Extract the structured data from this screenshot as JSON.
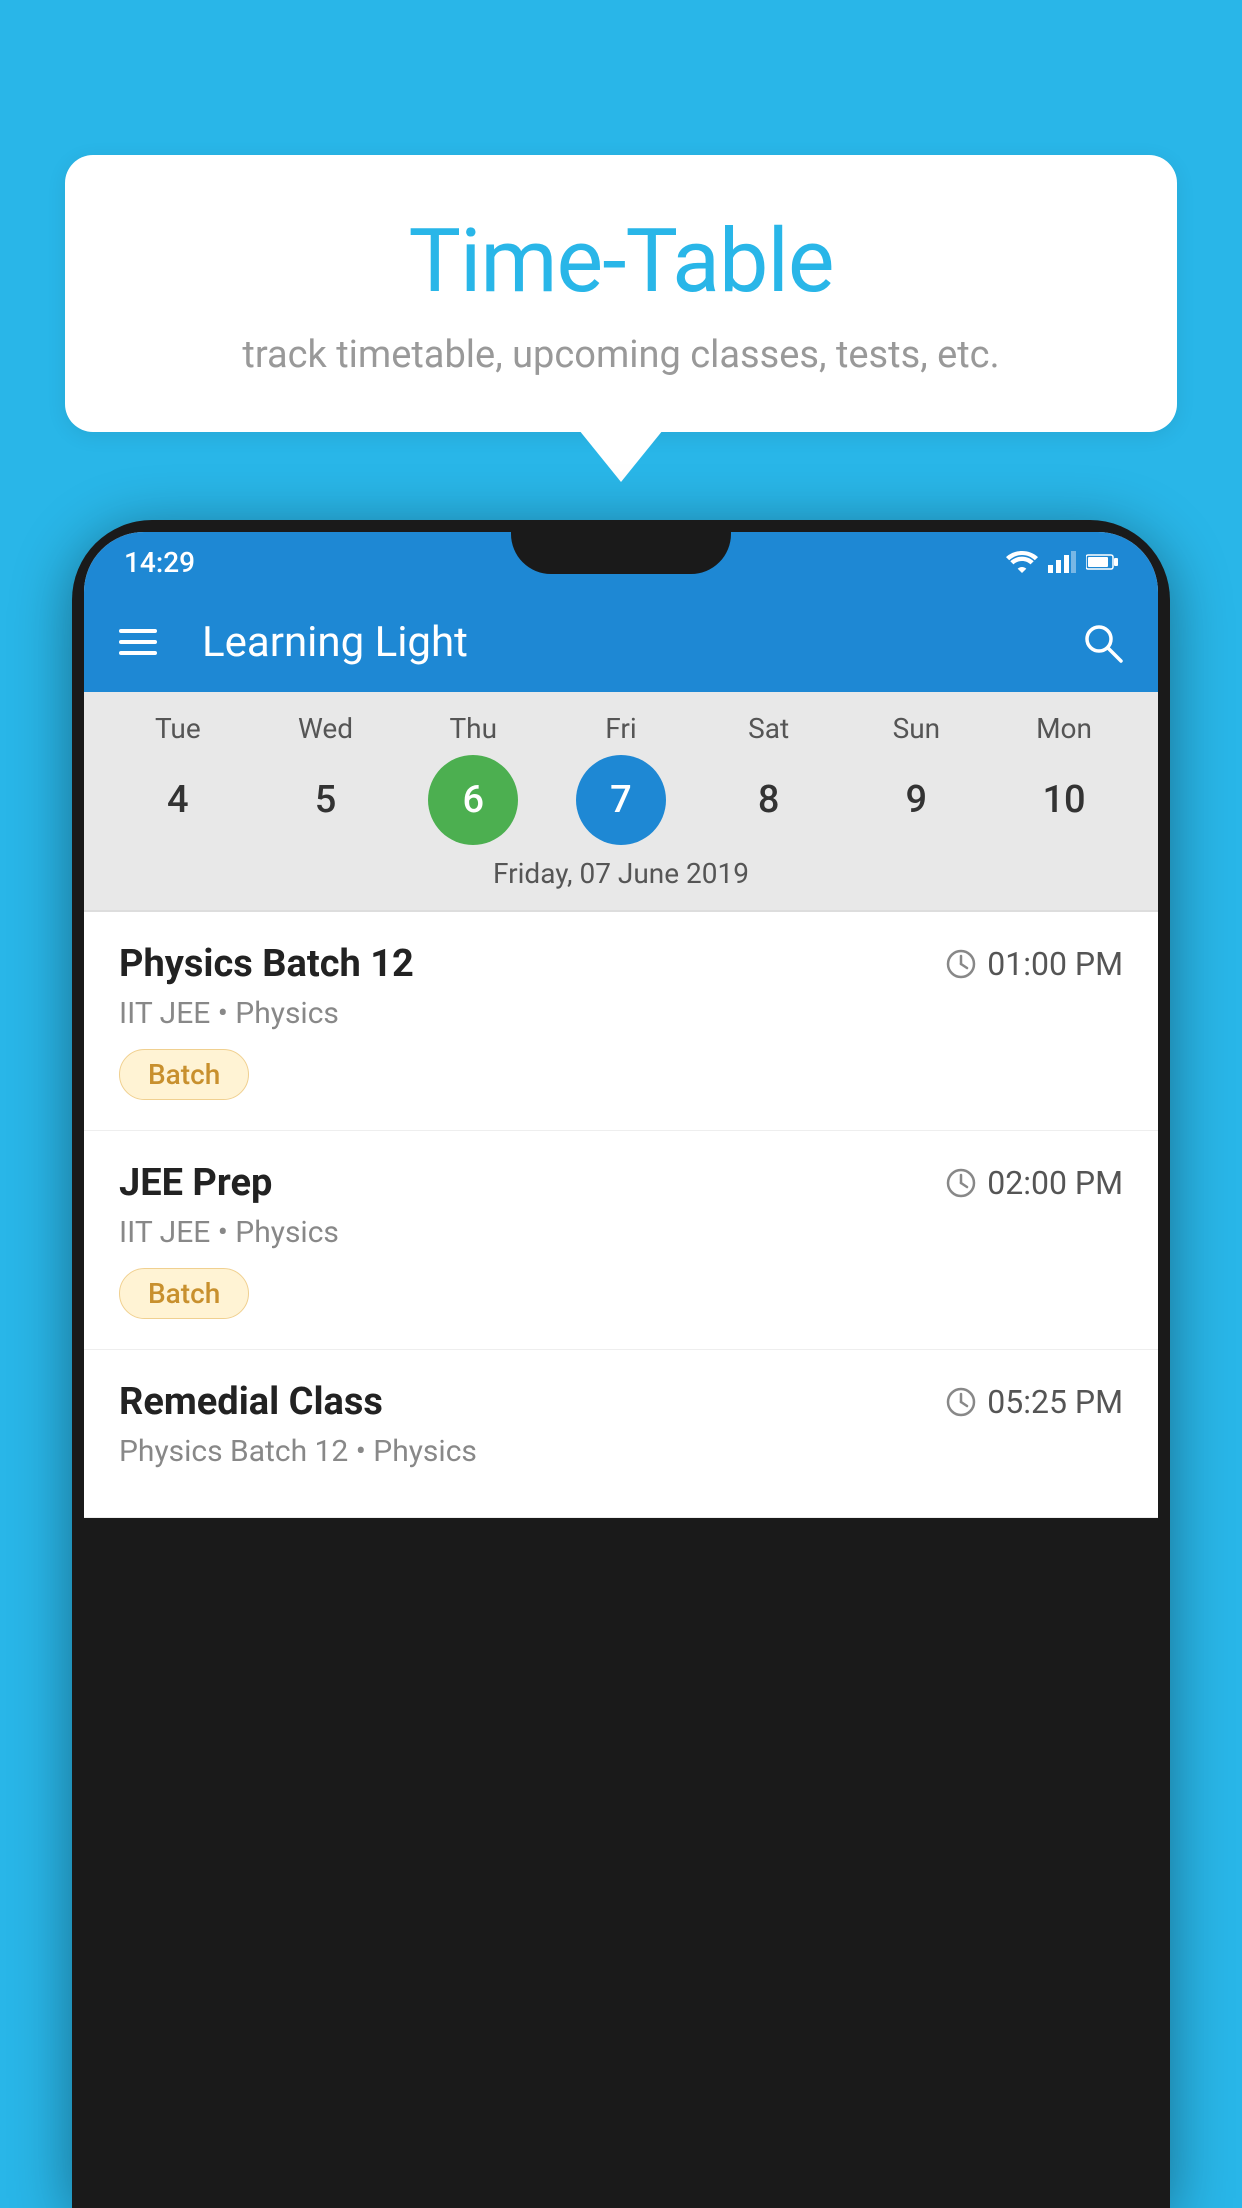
{
  "background_color": "#29b6e8",
  "speech_bubble": {
    "title": "Time-Table",
    "subtitle": "track timetable, upcoming classes, tests, etc."
  },
  "phone": {
    "status_bar": {
      "time": "14:29"
    },
    "app_bar": {
      "title": "Learning Light"
    },
    "calendar": {
      "days": [
        "Tue",
        "Wed",
        "Thu",
        "Fri",
        "Sat",
        "Sun",
        "Mon"
      ],
      "dates": [
        "4",
        "5",
        "6",
        "7",
        "8",
        "9",
        "10"
      ],
      "today_index": 2,
      "selected_index": 3,
      "selected_label": "Friday, 07 June 2019"
    },
    "schedule": [
      {
        "title": "Physics Batch 12",
        "time": "01:00 PM",
        "subtitle": "IIT JEE • Physics",
        "badge": "Batch"
      },
      {
        "title": "JEE Prep",
        "time": "02:00 PM",
        "subtitle": "IIT JEE • Physics",
        "badge": "Batch"
      },
      {
        "title": "Remedial Class",
        "time": "05:25 PM",
        "subtitle": "Physics Batch 12 • Physics",
        "badge": ""
      }
    ]
  }
}
